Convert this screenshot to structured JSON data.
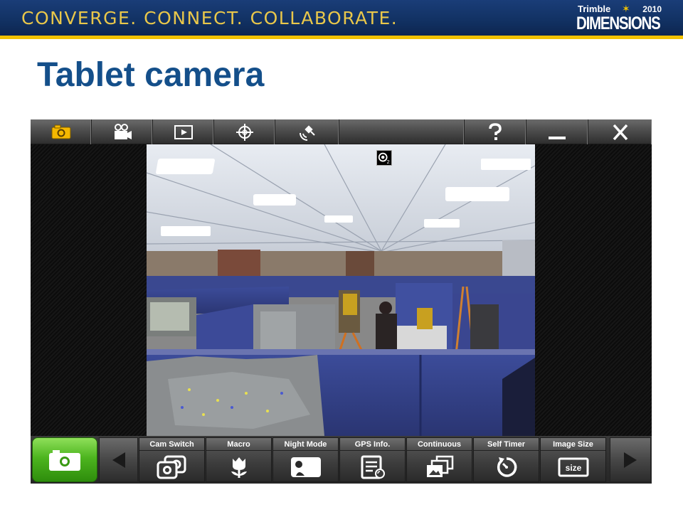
{
  "slide": {
    "tagline": "CONVERGE. CONNECT. COLLABORATE.",
    "brand_top": "Trimble",
    "brand_year": "2010",
    "brand_main": "DIMENSIONS",
    "title": "Tablet camera"
  },
  "top_toolbar": {
    "buttons": [
      {
        "name": "camera-mode",
        "icon": "camera-icon",
        "active": true
      },
      {
        "name": "video-mode",
        "icon": "video-camera-icon"
      },
      {
        "name": "playback",
        "icon": "play-icon"
      },
      {
        "name": "gps",
        "icon": "crosshair-icon"
      },
      {
        "name": "satellite",
        "icon": "satellite-icon"
      },
      {
        "name": "help",
        "icon": "question-icon"
      },
      {
        "name": "minimize",
        "icon": "minimize-icon"
      },
      {
        "name": "close",
        "icon": "close-icon"
      }
    ]
  },
  "viewfinder": {
    "badge_subscript": "2"
  },
  "bottom_toolbar": {
    "options": [
      {
        "label": "Cam Switch",
        "icon": "cam-switch-icon"
      },
      {
        "label": "Macro",
        "icon": "flower-icon"
      },
      {
        "label": "Night Mode",
        "icon": "night-mode-icon"
      },
      {
        "label": "GPS Info.",
        "icon": "gps-info-icon"
      },
      {
        "label": "Continuous",
        "icon": "continuous-icon"
      },
      {
        "label": "Self Timer",
        "icon": "timer-icon"
      },
      {
        "label": "Image Size",
        "icon": "image-size-icon",
        "text": "size"
      }
    ]
  },
  "colors": {
    "accent_gold": "#f2c200",
    "banner_blue": "#123264",
    "title_blue": "#144f8a",
    "shutter_green": "#4db51f",
    "camera_active": "#f5b800"
  }
}
